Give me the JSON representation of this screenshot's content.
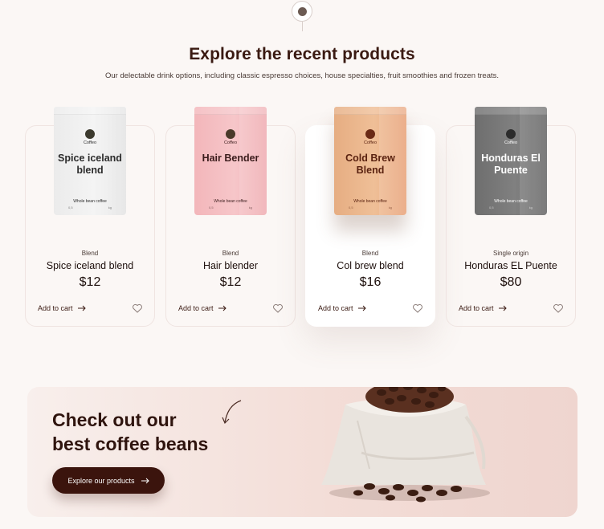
{
  "section": {
    "title": "Explore the recent products",
    "subtitle": "Our delectable drink options, including classic espresso choices, house specialties, fruit smoothies and frozen treats."
  },
  "products": [
    {
      "bag_name": "Spice iceland blend",
      "bag_brand": "Coffeo",
      "bag_kind": "Whole bean coffee",
      "bag_weight": "0,5",
      "bag_unit": "kg",
      "category": "Blend",
      "title": "Spice iceland blend",
      "price": "$12",
      "cart_label": "Add to cart",
      "bag_color": "white"
    },
    {
      "bag_name": "Hair Bender",
      "bag_brand": "Coffeo",
      "bag_kind": "Whole bean coffee",
      "bag_weight": "0,5",
      "bag_unit": "kg",
      "category": "Blend",
      "title": "Hair blender",
      "price": "$12",
      "cart_label": "Add to cart",
      "bag_color": "pink"
    },
    {
      "bag_name": "Cold Brew Blend",
      "bag_brand": "Coffeo",
      "bag_kind": "Whole bean coffee",
      "bag_weight": "0,5",
      "bag_unit": "kg",
      "category": "Blend",
      "title": "Col brew blend",
      "price": "$16",
      "cart_label": "Add to cart",
      "bag_color": "tan",
      "active": true
    },
    {
      "bag_name": "Honduras El Puente",
      "bag_brand": "Coffeo",
      "bag_kind": "Whole bean coffee",
      "bag_weight": "0,5",
      "bag_unit": "kg",
      "category": "Single origin",
      "title": "Honduras EL Puente",
      "price": "$80",
      "cart_label": "Add to cart",
      "bag_color": "grey"
    }
  ],
  "banner": {
    "title_line1": "Check out our",
    "title_line2": "best coffee beans",
    "button_label": "Explore our products"
  },
  "colors": {
    "brand_dark": "#3b140d",
    "background": "#fbf7f5",
    "banner_bg": "#f3ddd7"
  }
}
